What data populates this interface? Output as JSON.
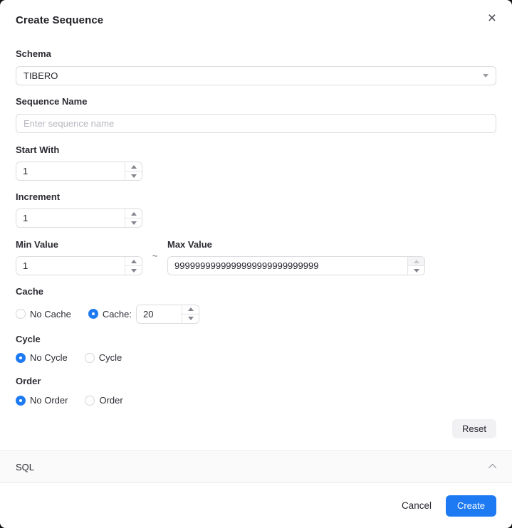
{
  "dialog": {
    "title": "Create Sequence"
  },
  "fields": {
    "schema": {
      "label": "Schema",
      "value": "TIBERO"
    },
    "sequence_name": {
      "label": "Sequence Name",
      "placeholder": "Enter sequence name",
      "value": ""
    },
    "start_with": {
      "label": "Start With",
      "value": "1"
    },
    "increment": {
      "label": "Increment",
      "value": "1"
    },
    "min_value": {
      "label": "Min Value",
      "value": "1"
    },
    "range_separator": "~",
    "max_value": {
      "label": "Max Value",
      "value": "9999999999999999999999999999",
      "spinner_up_disabled": true
    },
    "cache": {
      "label": "Cache",
      "options": [
        {
          "label": "No Cache",
          "selected": false
        },
        {
          "label": "Cache:",
          "selected": true
        }
      ],
      "cache_size": "20"
    },
    "cycle": {
      "label": "Cycle",
      "options": [
        {
          "label": "No Cycle",
          "selected": true
        },
        {
          "label": "Cycle",
          "selected": false
        }
      ]
    },
    "order": {
      "label": "Order",
      "options": [
        {
          "label": "No Order",
          "selected": true
        },
        {
          "label": "Order",
          "selected": false
        }
      ]
    }
  },
  "buttons": {
    "reset": "Reset",
    "cancel": "Cancel",
    "create": "Create"
  },
  "sql_section": {
    "label": "SQL"
  },
  "icons": {
    "close": "×"
  },
  "colors": {
    "accent": "#1d7af3",
    "border": "#dcdce1",
    "surface": "#ffffff",
    "sql_bar_bg": "#fafafb",
    "reset_bg": "#f1f1f4"
  }
}
